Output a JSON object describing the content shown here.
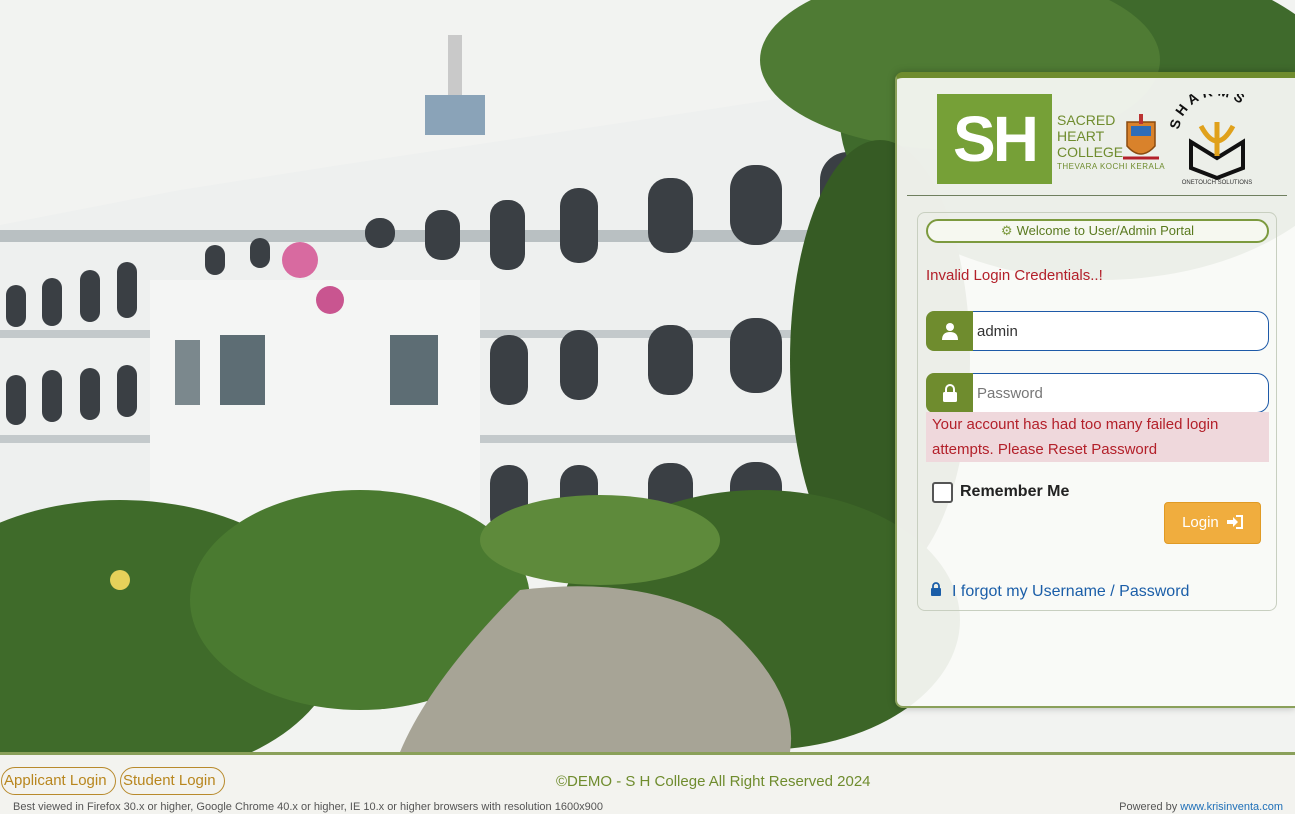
{
  "portal": {
    "welcome": "Welcome to User/Admin Portal",
    "error_message": "Invalid Login Credentials..!",
    "username": {
      "value": "admin"
    },
    "password": {
      "placeholder": "Password"
    },
    "alert": "Your account has had too many failed login attempts. Please Reset Password",
    "remember_label": "Remember Me",
    "login_label": "Login",
    "forgot_label": "I forgot my Username / Password"
  },
  "logos": {
    "college_mark": "SH",
    "college_name_lines": [
      "SACRED",
      "HEART",
      "COLLEGE"
    ],
    "college_location": "THEVARA  KOCHI  KERALA",
    "partner_name": "SHARMS",
    "partner_tagline": "ONETOUCH SOLUTIONS"
  },
  "footer": {
    "applicant_login": "Applicant Login",
    "student_login": "Student Login",
    "copyright": "©DEMO - S H College All Right Reserved 2024",
    "best_viewed": "Best viewed in Firefox 30.x or higher, Google Chrome 40.x or higher, IE 10.x or higher browsers with resolution 1600x900",
    "powered_by_prefix": "Powered by",
    "powered_by_link": "www.krisinventa.com"
  },
  "colors": {
    "brand_green": "#6f8c2e",
    "error_red": "#b3202a",
    "login_orange": "#f0ad3e",
    "link_blue": "#1b5ea8"
  },
  "icons": [
    "gear-icon",
    "user-icon",
    "lock-icon",
    "sign-in-icon",
    "padlock-icon"
  ]
}
